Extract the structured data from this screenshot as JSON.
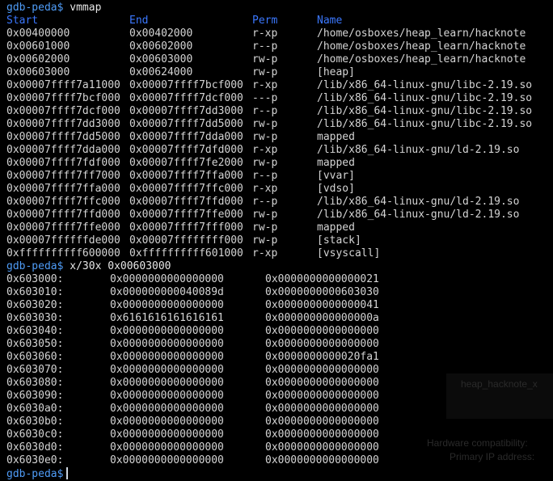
{
  "prompt": "gdb-peda$",
  "commands": {
    "vmmap": "vmmap",
    "examine": "x/30x 0x00603000"
  },
  "vmmap_headers": {
    "start": "Start",
    "end": "End",
    "perm": "Perm",
    "name": "Name"
  },
  "vmmap_rows": [
    {
      "start": "0x00400000",
      "end": "0x00402000",
      "perm": "r-xp",
      "name": "/home/osboxes/heap_learn/hacknote"
    },
    {
      "start": "0x00601000",
      "end": "0x00602000",
      "perm": "r--p",
      "name": "/home/osboxes/heap_learn/hacknote"
    },
    {
      "start": "0x00602000",
      "end": "0x00603000",
      "perm": "rw-p",
      "name": "/home/osboxes/heap_learn/hacknote"
    },
    {
      "start": "0x00603000",
      "end": "0x00624000",
      "perm": "rw-p",
      "name": "[heap]"
    },
    {
      "start": "0x00007ffff7a11000",
      "end": "0x00007ffff7bcf000",
      "perm": "r-xp",
      "name": "/lib/x86_64-linux-gnu/libc-2.19.so"
    },
    {
      "start": "0x00007ffff7bcf000",
      "end": "0x00007ffff7dcf000",
      "perm": "---p",
      "name": "/lib/x86_64-linux-gnu/libc-2.19.so"
    },
    {
      "start": "0x00007ffff7dcf000",
      "end": "0x00007ffff7dd3000",
      "perm": "r--p",
      "name": "/lib/x86_64-linux-gnu/libc-2.19.so"
    },
    {
      "start": "0x00007ffff7dd3000",
      "end": "0x00007ffff7dd5000",
      "perm": "rw-p",
      "name": "/lib/x86_64-linux-gnu/libc-2.19.so"
    },
    {
      "start": "0x00007ffff7dd5000",
      "end": "0x00007ffff7dda000",
      "perm": "rw-p",
      "name": "mapped"
    },
    {
      "start": "0x00007ffff7dda000",
      "end": "0x00007ffff7dfd000",
      "perm": "r-xp",
      "name": "/lib/x86_64-linux-gnu/ld-2.19.so"
    },
    {
      "start": "0x00007ffff7fdf000",
      "end": "0x00007ffff7fe2000",
      "perm": "rw-p",
      "name": "mapped"
    },
    {
      "start": "0x00007ffff7ff7000",
      "end": "0x00007ffff7ffa000",
      "perm": "r--p",
      "name": "[vvar]"
    },
    {
      "start": "0x00007ffff7ffa000",
      "end": "0x00007ffff7ffc000",
      "perm": "r-xp",
      "name": "[vdso]"
    },
    {
      "start": "0x00007ffff7ffc000",
      "end": "0x00007ffff7ffd000",
      "perm": "r--p",
      "name": "/lib/x86_64-linux-gnu/ld-2.19.so"
    },
    {
      "start": "0x00007ffff7ffd000",
      "end": "0x00007ffff7ffe000",
      "perm": "rw-p",
      "name": "/lib/x86_64-linux-gnu/ld-2.19.so"
    },
    {
      "start": "0x00007ffff7ffe000",
      "end": "0x00007ffff7fff000",
      "perm": "rw-p",
      "name": "mapped"
    },
    {
      "start": "0x00007ffffffde000",
      "end": "0x00007ffffffff000",
      "perm": "rw-p",
      "name": "[stack]"
    },
    {
      "start": "0xffffffffff600000",
      "end": "0xffffffffff601000",
      "perm": "r-xp",
      "name": "[vsyscall]"
    }
  ],
  "memory_rows": [
    {
      "addr": "0x603000:",
      "v1": "0x0000000000000000",
      "v2": "0x0000000000000021"
    },
    {
      "addr": "0x603010:",
      "v1": "0x000000000040089d",
      "v2": "0x0000000000603030"
    },
    {
      "addr": "0x603020:",
      "v1": "0x0000000000000000",
      "v2": "0x0000000000000041"
    },
    {
      "addr": "0x603030:",
      "v1": "0x6161616161616161",
      "v2": "0x000000000000000a"
    },
    {
      "addr": "0x603040:",
      "v1": "0x0000000000000000",
      "v2": "0x0000000000000000"
    },
    {
      "addr": "0x603050:",
      "v1": "0x0000000000000000",
      "v2": "0x0000000000000000"
    },
    {
      "addr": "0x603060:",
      "v1": "0x0000000000000000",
      "v2": "0x0000000000020fa1"
    },
    {
      "addr": "0x603070:",
      "v1": "0x0000000000000000",
      "v2": "0x0000000000000000"
    },
    {
      "addr": "0x603080:",
      "v1": "0x0000000000000000",
      "v2": "0x0000000000000000"
    },
    {
      "addr": "0x603090:",
      "v1": "0x0000000000000000",
      "v2": "0x0000000000000000"
    },
    {
      "addr": "0x6030a0:",
      "v1": "0x0000000000000000",
      "v2": "0x0000000000000000"
    },
    {
      "addr": "0x6030b0:",
      "v1": "0x0000000000000000",
      "v2": "0x0000000000000000"
    },
    {
      "addr": "0x6030c0:",
      "v1": "0x0000000000000000",
      "v2": "0x0000000000000000"
    },
    {
      "addr": "0x6030d0:",
      "v1": "0x0000000000000000",
      "v2": "0x0000000000000000"
    },
    {
      "addr": "0x6030e0:",
      "v1": "0x0000000000000000",
      "v2": "0x0000000000000000"
    }
  ],
  "background_overlay": {
    "name": "heap_hacknote_x",
    "hardware_compatibility": "Hardware compatibility:",
    "primary_ip": "Primary IP address:"
  },
  "colors": {
    "background": "#000000",
    "prompt": "#4f9cf7",
    "header": "#3b78ff",
    "text": "#d4d4d4"
  }
}
